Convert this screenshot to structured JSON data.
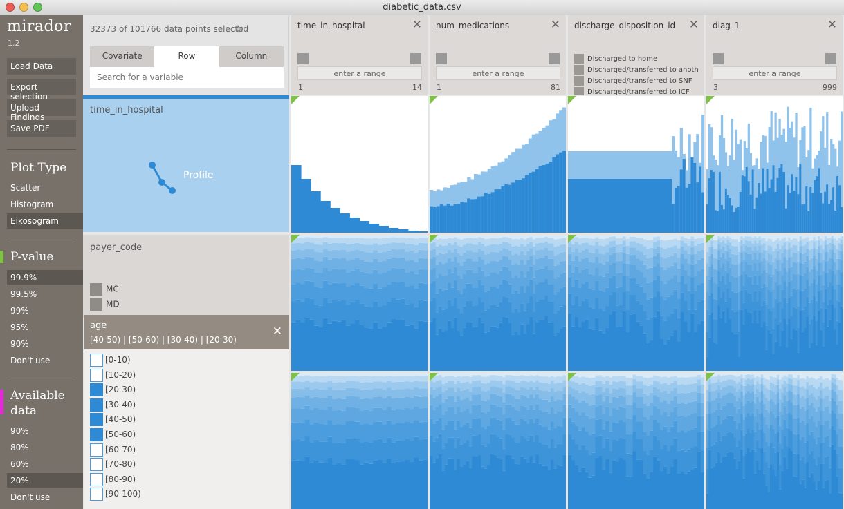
{
  "window": {
    "title": "diabetic_data.csv"
  },
  "sidebar": {
    "app_name": "mirador",
    "version": "1.2",
    "actions": [
      "Load Data",
      "Export selection",
      "Upload Findings",
      "Save PDF"
    ],
    "plot_type": {
      "title": "Plot Type",
      "options": [
        "Scatter",
        "Histogram",
        "Eikosogram"
      ],
      "selected": "Eikosogram"
    },
    "p_value": {
      "title": "P-value",
      "options": [
        "99.9%",
        "99.5%",
        "99%",
        "95%",
        "90%",
        "Don't use"
      ],
      "selected": "99.9%",
      "marker_color": "#7dc242"
    },
    "available_data": {
      "title_line1": "Available",
      "title_line2": "data",
      "options": [
        "90%",
        "80%",
        "60%",
        "20%",
        "Don't use"
      ],
      "selected": "20%",
      "marker_color": "#e629d8"
    }
  },
  "controls": {
    "selection_count": "32373 of 101766 data points selected",
    "refresh_icon": "refresh-icon",
    "tabs": [
      "Covariate",
      "Row",
      "Column"
    ],
    "active_tab": "Row",
    "search_placeholder": "Search for a variable"
  },
  "columns": [
    {
      "name": "time_in_hospital",
      "kind": "numeric",
      "range_placeholder": "enter a range",
      "min": "1",
      "max": "14"
    },
    {
      "name": "num_medications",
      "kind": "numeric",
      "range_placeholder": "enter a range",
      "min": "1",
      "max": "81"
    },
    {
      "name": "discharge_disposition_id",
      "kind": "categorical",
      "categories": [
        "Discharged to home",
        "Discharged/transferred to another…",
        "Discharged/transferred to SNF",
        "Discharged/transferred to ICF"
      ]
    },
    {
      "name": "diag_1",
      "kind": "numeric",
      "range_placeholder": "enter a range",
      "min": "3",
      "max": "999"
    }
  ],
  "rows": [
    {
      "name": "time_in_hospital",
      "mode_label": "Profile",
      "selected": true
    },
    {
      "name": "payer_code",
      "categories": [
        "MC",
        "MD"
      ]
    }
  ],
  "age_filter": {
    "title": "age",
    "selected_summary": "[40-50) | [50-60) | [30-40) | [20-30)",
    "options": [
      {
        "label": "[0-10)",
        "checked": false
      },
      {
        "label": "[10-20)",
        "checked": false
      },
      {
        "label": "[20-30)",
        "checked": true
      },
      {
        "label": "[30-40)",
        "checked": true
      },
      {
        "label": "[40-50)",
        "checked": true
      },
      {
        "label": "[50-60)",
        "checked": true
      },
      {
        "label": "[60-70)",
        "checked": false
      },
      {
        "label": "[70-80)",
        "checked": false
      },
      {
        "label": "[80-90)",
        "checked": false
      },
      {
        "label": "[90-100)",
        "checked": false
      }
    ]
  },
  "colors": {
    "dark_blue": "#2f8ad6",
    "light_blue": "#90c3ec",
    "significance_marker": "#7dc242"
  }
}
